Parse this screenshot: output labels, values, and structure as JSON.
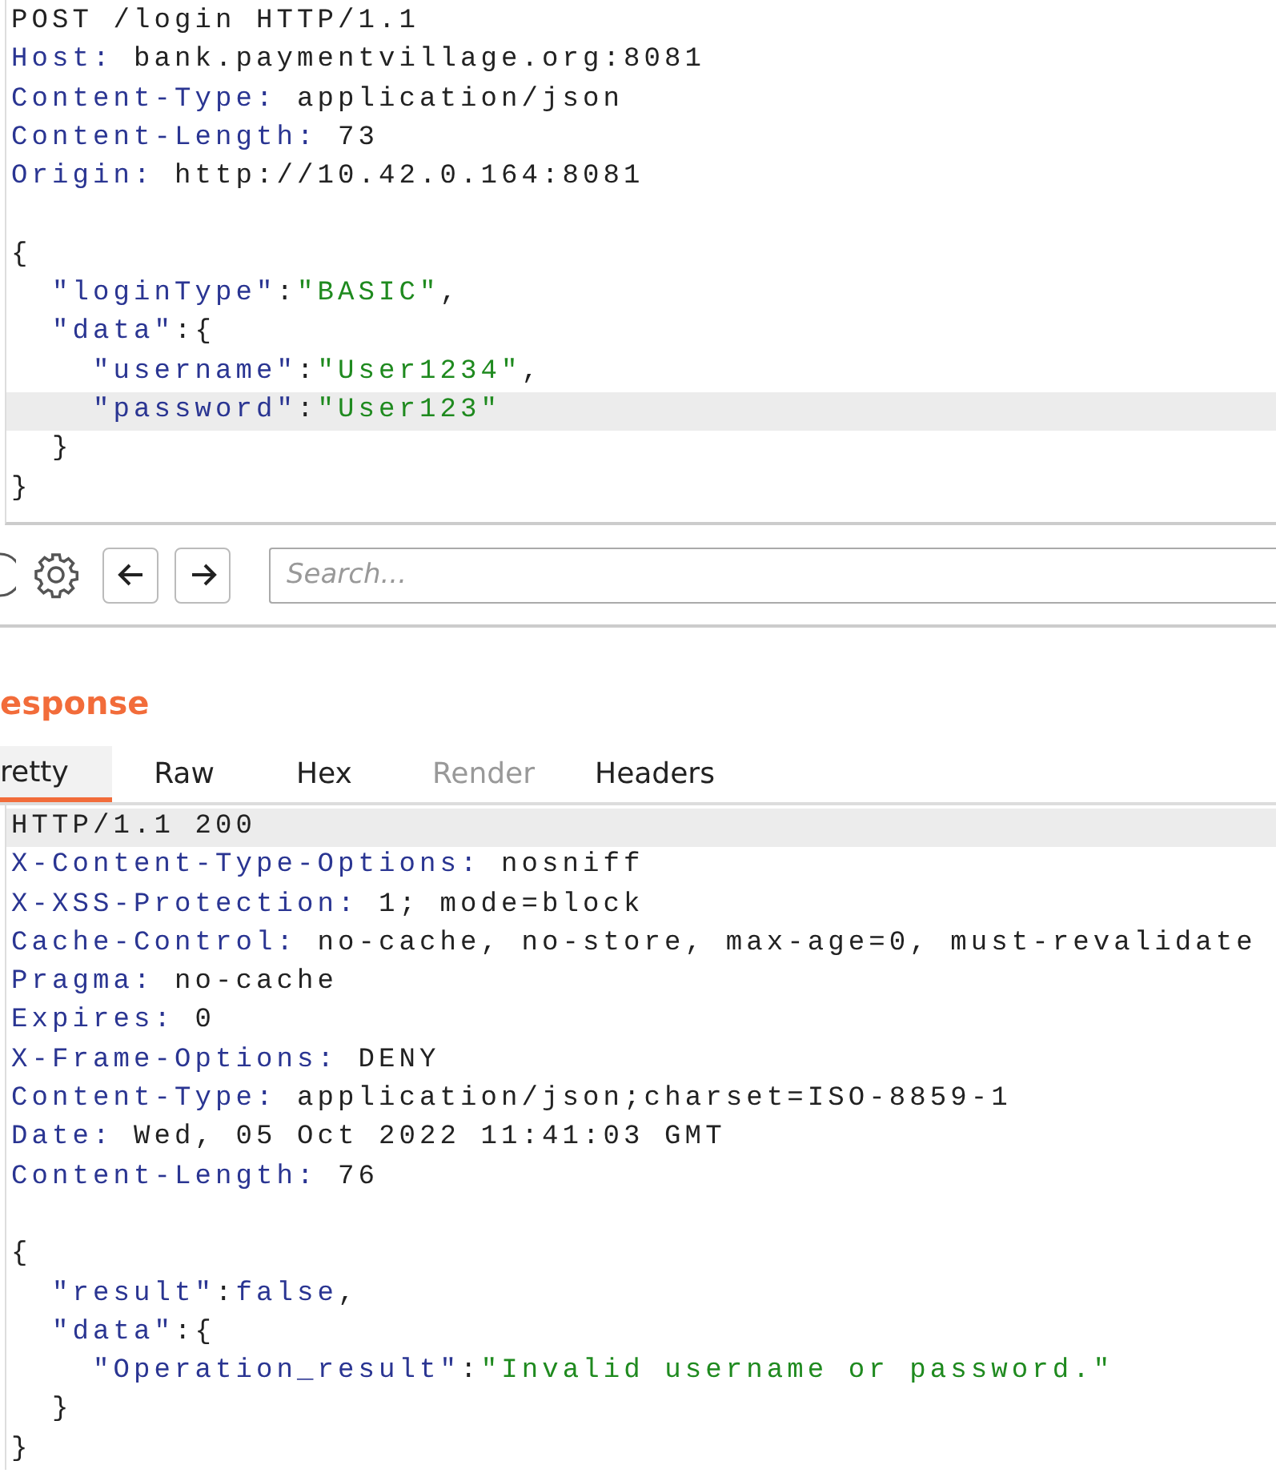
{
  "request": {
    "lines": [
      {
        "parts": [
          {
            "kind": "plain",
            "text": "POST /login HTTP/1.1"
          }
        ],
        "highlighted": false
      },
      {
        "parts": [
          {
            "kind": "key",
            "text": "Host:"
          },
          {
            "kind": "plain",
            "text": " bank.paymentvillage.org:8081"
          }
        ],
        "highlighted": false
      },
      {
        "parts": [
          {
            "kind": "key",
            "text": "Content-Type:"
          },
          {
            "kind": "plain",
            "text": " application/json"
          }
        ],
        "highlighted": false
      },
      {
        "parts": [
          {
            "kind": "key",
            "text": "Content-Length:"
          },
          {
            "kind": "plain",
            "text": " 73"
          }
        ],
        "highlighted": false
      },
      {
        "parts": [
          {
            "kind": "key",
            "text": "Origin:"
          },
          {
            "kind": "plain",
            "text": " http://10.42.0.164:8081"
          }
        ],
        "highlighted": false
      },
      {
        "parts": [
          {
            "kind": "plain",
            "text": "{"
          }
        ],
        "highlighted": false,
        "blank_before": true
      },
      {
        "parts": [
          {
            "kind": "key",
            "text": "  \"loginType\""
          },
          {
            "kind": "plain",
            "text": ":"
          },
          {
            "kind": "string",
            "text": "\"BASIC\""
          },
          {
            "kind": "plain",
            "text": ","
          }
        ],
        "highlighted": false
      },
      {
        "parts": [
          {
            "kind": "key",
            "text": "  \"data\""
          },
          {
            "kind": "plain",
            "text": ":{"
          }
        ],
        "highlighted": false
      },
      {
        "parts": [
          {
            "kind": "key",
            "text": "    \"username\""
          },
          {
            "kind": "plain",
            "text": ":"
          },
          {
            "kind": "string",
            "text": "\"User1234\""
          },
          {
            "kind": "plain",
            "text": ","
          }
        ],
        "highlighted": false
      },
      {
        "parts": [
          {
            "kind": "key",
            "text": "    \"password\""
          },
          {
            "kind": "plain",
            "text": ":"
          },
          {
            "kind": "string",
            "text": "\"User123\""
          }
        ],
        "highlighted": true
      },
      {
        "parts": [
          {
            "kind": "plain",
            "text": "  }"
          }
        ],
        "highlighted": false
      },
      {
        "parts": [
          {
            "kind": "plain",
            "text": "}"
          }
        ],
        "highlighted": false
      }
    ]
  },
  "toolbar": {
    "search": {
      "placeholder": "Search..."
    }
  },
  "response": {
    "title": "esponse",
    "tabs": [
      {
        "label": "retty",
        "selected": true,
        "disabled": false
      },
      {
        "label": "Raw",
        "selected": false,
        "disabled": false
      },
      {
        "label": "Hex",
        "selected": false,
        "disabled": false
      },
      {
        "label": "Render",
        "selected": false,
        "disabled": true
      },
      {
        "label": "Headers",
        "selected": false,
        "disabled": false
      }
    ],
    "lines": [
      {
        "parts": [
          {
            "kind": "plain",
            "text": "HTTP/1.1 200"
          }
        ],
        "highlighted": true
      },
      {
        "parts": [
          {
            "kind": "key",
            "text": "X-Content-Type-Options:"
          },
          {
            "kind": "plain",
            "text": " nosniff"
          }
        ],
        "highlighted": false
      },
      {
        "parts": [
          {
            "kind": "key",
            "text": "X-XSS-Protection:"
          },
          {
            "kind": "plain",
            "text": " 1; mode=block"
          }
        ],
        "highlighted": false
      },
      {
        "parts": [
          {
            "kind": "key",
            "text": "Cache-Control:"
          },
          {
            "kind": "plain",
            "text": " no-cache, no-store, max-age=0, must-revalidate"
          }
        ],
        "highlighted": false
      },
      {
        "parts": [
          {
            "kind": "key",
            "text": "Pragma:"
          },
          {
            "kind": "plain",
            "text": " no-cache"
          }
        ],
        "highlighted": false
      },
      {
        "parts": [
          {
            "kind": "key",
            "text": "Expires:"
          },
          {
            "kind": "plain",
            "text": " 0"
          }
        ],
        "highlighted": false
      },
      {
        "parts": [
          {
            "kind": "key",
            "text": "X-Frame-Options:"
          },
          {
            "kind": "plain",
            "text": " DENY"
          }
        ],
        "highlighted": false
      },
      {
        "parts": [
          {
            "kind": "key",
            "text": "Content-Type:"
          },
          {
            "kind": "plain",
            "text": " application/json;charset=ISO-8859-1"
          }
        ],
        "highlighted": false
      },
      {
        "parts": [
          {
            "kind": "key",
            "text": "Date:"
          },
          {
            "kind": "plain",
            "text": " Wed, 05 Oct 2022 11:41:03 GMT"
          }
        ],
        "highlighted": false
      },
      {
        "parts": [
          {
            "kind": "key",
            "text": "Content-Length:"
          },
          {
            "kind": "plain",
            "text": " 76"
          }
        ],
        "highlighted": false
      },
      {
        "parts": [
          {
            "kind": "plain",
            "text": "{"
          }
        ],
        "highlighted": false,
        "blank_before": true
      },
      {
        "parts": [
          {
            "kind": "key",
            "text": "  \"result\""
          },
          {
            "kind": "plain",
            "text": ":"
          },
          {
            "kind": "key",
            "text": "false"
          },
          {
            "kind": "plain",
            "text": ","
          }
        ],
        "highlighted": false
      },
      {
        "parts": [
          {
            "kind": "key",
            "text": "  \"data\""
          },
          {
            "kind": "plain",
            "text": ":{"
          }
        ],
        "highlighted": false
      },
      {
        "parts": [
          {
            "kind": "key",
            "text": "    \"Operation_result\""
          },
          {
            "kind": "plain",
            "text": ":"
          },
          {
            "kind": "string",
            "text": "\"Invalid username or password.\""
          }
        ],
        "highlighted": false
      },
      {
        "parts": [
          {
            "kind": "plain",
            "text": "  }"
          }
        ],
        "highlighted": false
      },
      {
        "parts": [
          {
            "kind": "plain",
            "text": "}"
          }
        ],
        "highlighted": false
      }
    ]
  }
}
